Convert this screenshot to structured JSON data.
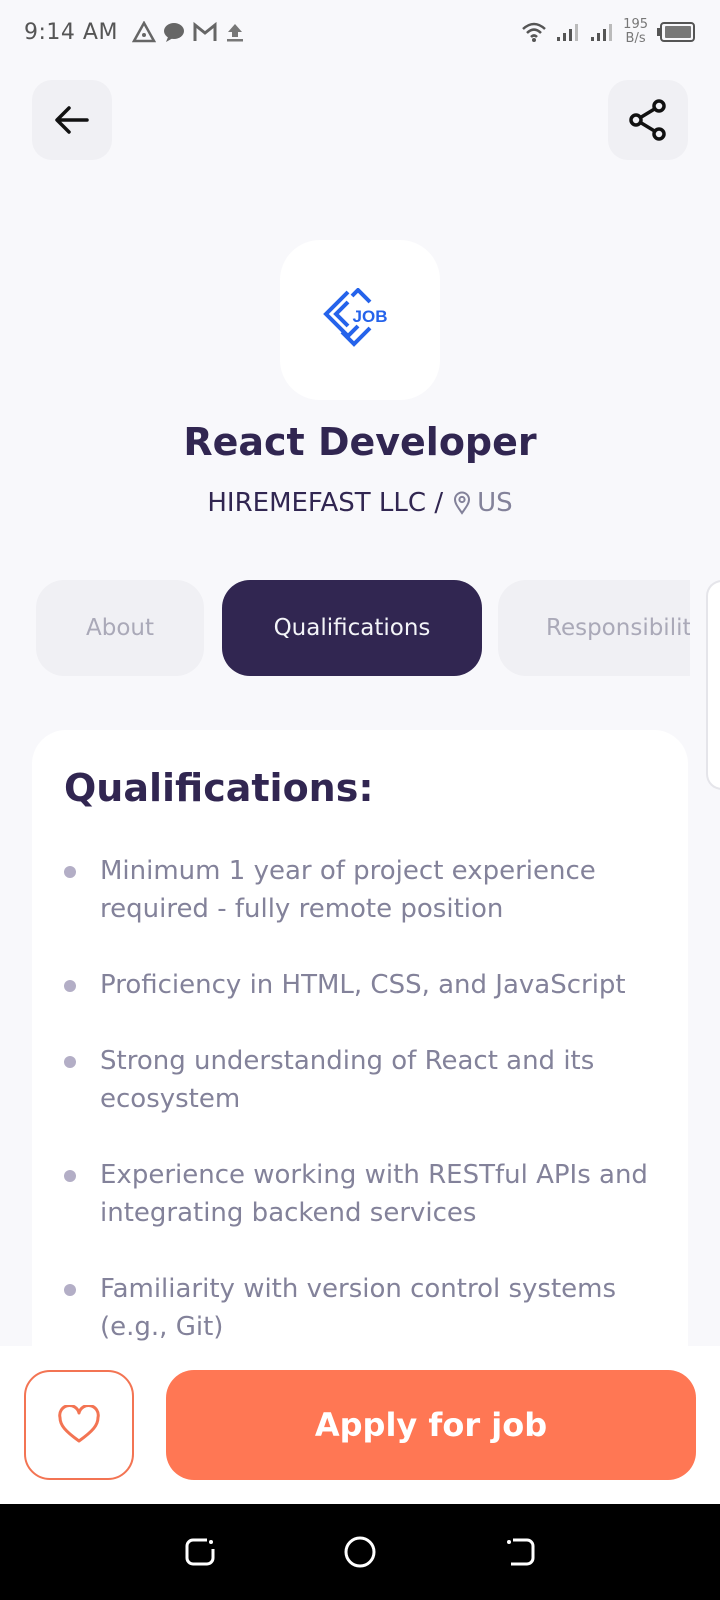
{
  "status_bar": {
    "time": "9:14 AM",
    "net_speed_value": "195",
    "net_speed_unit": "B/s"
  },
  "header": {
    "back_icon": "arrow-left-icon",
    "share_icon": "share-icon"
  },
  "job": {
    "title": "React Developer",
    "company": "HIREMEFAST LLC /",
    "location": "US",
    "logo_text": "JOB"
  },
  "tabs": [
    {
      "label": "About",
      "active": false
    },
    {
      "label": "Qualifications",
      "active": true
    },
    {
      "label": "Responsibilities",
      "active": false
    }
  ],
  "qualifications": {
    "heading": "Qualifications:",
    "points": [
      "Minimum 1 year of project experience required - fully remote position",
      "Proficiency in HTML, CSS, and JavaScript",
      "Strong understanding of React and its ecosystem",
      "Experience working with RESTful APIs and integrating backend services",
      "Familiarity with version control systems (e.g., Git)"
    ]
  },
  "footer": {
    "apply_label": "Apply for job",
    "favorite_icon": "heart-icon"
  },
  "colors": {
    "primary": "#312651",
    "accent": "#FF7754",
    "gray": "#83829A",
    "background": "#F8F8FB"
  }
}
